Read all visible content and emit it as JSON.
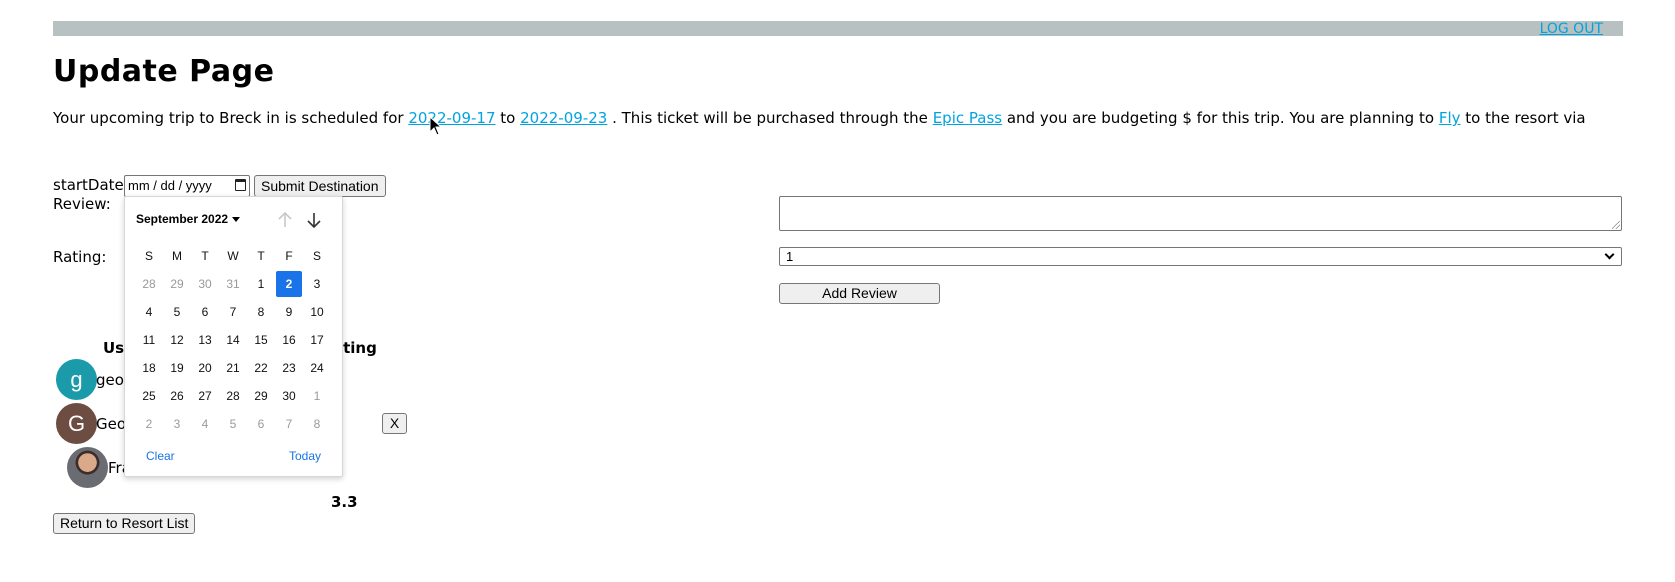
{
  "header": {
    "logout_label": "LOG OUT"
  },
  "page_title": "Update Page",
  "trip": {
    "prefix": "Your upcoming trip to Breck in is scheduled for",
    "start_date": "2022-09-17",
    "to": "to",
    "end_date": "2022-09-23",
    "mid": ". This ticket will be purchased through the",
    "pass": "Epic Pass",
    "budget_text": "and you are budgeting $ for this trip. You are planning to",
    "travel_mode": "Fly",
    "suffix": "to the resort via"
  },
  "form": {
    "start_label": "startDate:",
    "date_placeholder": "mm / dd / yyyy",
    "submit_label": "Submit Destination",
    "review_label": "Review:",
    "rating_label": "Rating:",
    "rating_value": "1",
    "add_review_label": "Add Review"
  },
  "reviews": {
    "col_user": "Use",
    "col_rating": "ating",
    "rows": [
      {
        "avatar_letter": "g",
        "avatar_color": "#1b9aaa",
        "name": "geo"
      },
      {
        "avatar_letter": "G",
        "avatar_color": "#6d4c41",
        "name": "Geo",
        "delete_label": "X"
      },
      {
        "avatar_letter": "",
        "avatar_color": "photo",
        "name": "Fra"
      }
    ],
    "average": "3.3"
  },
  "return_label": "Return to Resort List",
  "datepicker": {
    "month_label": "September 2022",
    "weekdays": [
      "S",
      "M",
      "T",
      "W",
      "T",
      "F",
      "S"
    ],
    "weeks": [
      [
        "28",
        "29",
        "30",
        "31",
        "1",
        "2",
        "3"
      ],
      [
        "4",
        "5",
        "6",
        "7",
        "8",
        "9",
        "10"
      ],
      [
        "11",
        "12",
        "13",
        "14",
        "15",
        "16",
        "17"
      ],
      [
        "18",
        "19",
        "20",
        "21",
        "22",
        "23",
        "24"
      ],
      [
        "25",
        "26",
        "27",
        "28",
        "29",
        "30",
        "1"
      ],
      [
        "2",
        "3",
        "4",
        "5",
        "6",
        "7",
        "8"
      ]
    ],
    "selected_day": "2",
    "clear_label": "Clear",
    "today_label": "Today",
    "accent_color": "#1a73e8"
  }
}
